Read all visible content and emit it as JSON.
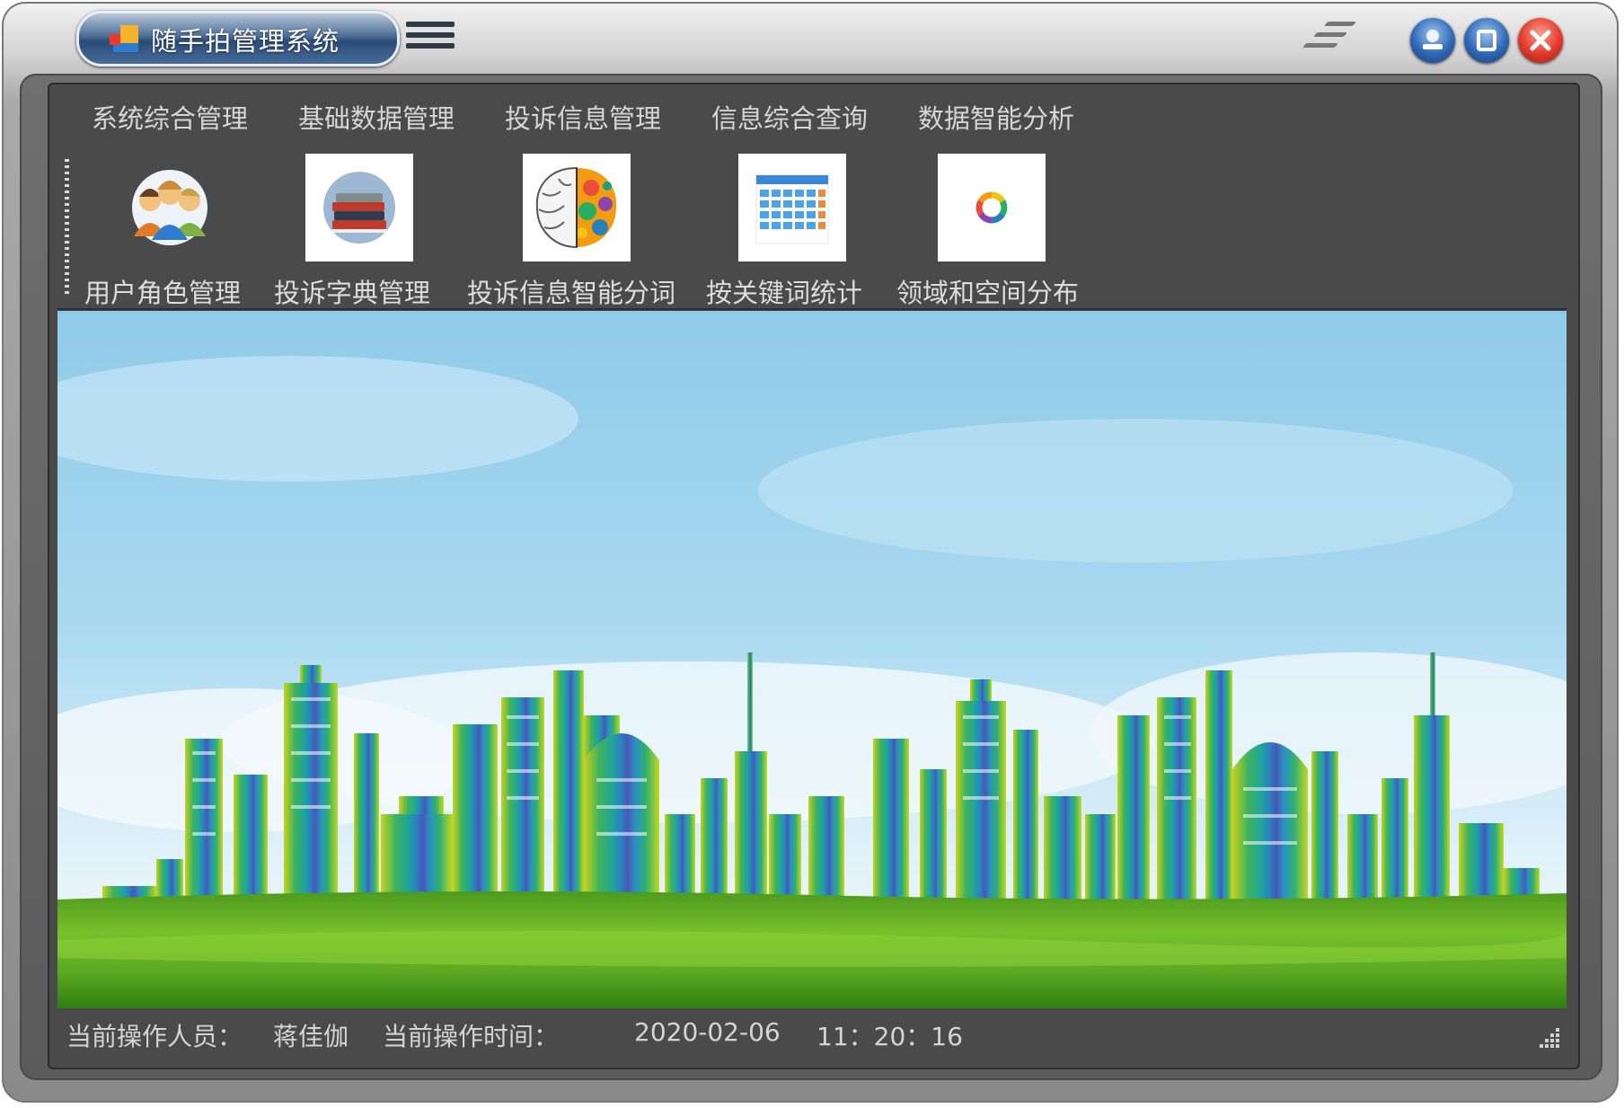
{
  "window": {
    "title": "随手拍管理系统"
  },
  "menu": {
    "items": [
      "系统综合管理",
      "基础数据管理",
      "投诉信息管理",
      "信息综合查询",
      "数据智能分析"
    ]
  },
  "toolbar": {
    "items": [
      {
        "label": "用户角色管理",
        "icon": "users-group-icon"
      },
      {
        "label": "投诉字典管理",
        "icon": "books-stack-icon"
      },
      {
        "label": "投诉信息智能分词",
        "icon": "brain-icon"
      },
      {
        "label": "按关键词统计",
        "icon": "calendar-icon"
      },
      {
        "label": "领域和空间分布",
        "icon": "color-ring-icon"
      }
    ]
  },
  "banner": {
    "description_icon": "city-skyline-image"
  },
  "status": {
    "operator_label": "当前操作人员：",
    "operator_name": "蒋佳伽",
    "time_label": "当前操作时间：",
    "date": "2020-02-06",
    "time": "11：20：16"
  },
  "colors": {
    "frame": "#5b5b5b",
    "panel": "#4a4a4a",
    "menu_text": "#d6d6d6",
    "title_pill": "#2b4b78",
    "close_button": "#e23a2c",
    "sky": "#9fd3ee",
    "grass": "#6cb52c"
  }
}
